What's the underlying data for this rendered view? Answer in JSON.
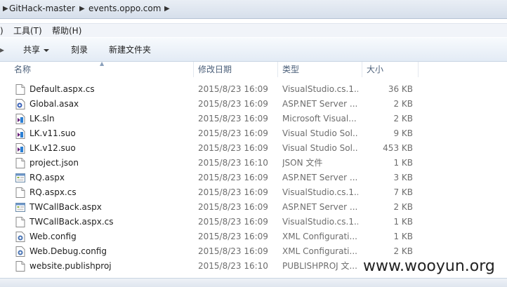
{
  "address": {
    "crumbs": [
      "GitHack-master",
      "events.oppo.com"
    ]
  },
  "menu": {
    "items": [
      "工具(T)",
      "帮助(H)"
    ],
    "partial_left": ")"
  },
  "toolbar": {
    "share_label": "共享",
    "burn_label": "刻录",
    "new_folder_label": "新建文件夹"
  },
  "columns": {
    "name": "名称",
    "date": "修改日期",
    "type": "类型",
    "size": "大小"
  },
  "files": [
    {
      "name": "Default.aspx.cs",
      "date": "2015/8/23 16:09",
      "type": "VisualStudio.cs.1...",
      "size": "36 KB",
      "icon": "file-cs-icon"
    },
    {
      "name": "Global.asax",
      "date": "2015/8/23 16:09",
      "type": "ASP.NET Server ...",
      "size": "2 KB",
      "icon": "file-asax-icon"
    },
    {
      "name": "LK.sln",
      "date": "2015/8/23 16:09",
      "type": "Microsoft Visual...",
      "size": "2 KB",
      "icon": "file-sln-icon"
    },
    {
      "name": "LK.v11.suo",
      "date": "2015/8/23 16:09",
      "type": "Visual Studio Sol...",
      "size": "9 KB",
      "icon": "file-suo-icon"
    },
    {
      "name": "LK.v12.suo",
      "date": "2015/8/23 16:09",
      "type": "Visual Studio Sol...",
      "size": "453 KB",
      "icon": "file-suo-icon"
    },
    {
      "name": "project.json",
      "date": "2015/8/23 16:10",
      "type": "JSON 文件",
      "size": "1 KB",
      "icon": "file-json-icon"
    },
    {
      "name": "RQ.aspx",
      "date": "2015/8/23 16:09",
      "type": "ASP.NET Server ...",
      "size": "3 KB",
      "icon": "file-aspx-icon"
    },
    {
      "name": "RQ.aspx.cs",
      "date": "2015/8/23 16:09",
      "type": "VisualStudio.cs.1...",
      "size": "7 KB",
      "icon": "file-cs-icon"
    },
    {
      "name": "TWCallBack.aspx",
      "date": "2015/8/23 16:09",
      "type": "ASP.NET Server ...",
      "size": "2 KB",
      "icon": "file-aspx-icon"
    },
    {
      "name": "TWCallBack.aspx.cs",
      "date": "2015/8/23 16:09",
      "type": "VisualStudio.cs.1...",
      "size": "1 KB",
      "icon": "file-cs-icon"
    },
    {
      "name": "Web.config",
      "date": "2015/8/23 16:09",
      "type": "XML Configurati...",
      "size": "1 KB",
      "icon": "file-config-icon"
    },
    {
      "name": "Web.Debug.config",
      "date": "2015/8/23 16:09",
      "type": "XML Configurati...",
      "size": "2 KB",
      "icon": "file-config-icon"
    },
    {
      "name": "website.publishproj",
      "date": "2015/8/23 16:10",
      "type": "PUBLISHPROJ 文...",
      "size": "",
      "icon": "file-generic-icon"
    }
  ],
  "watermark": "www.wooyun.org"
}
